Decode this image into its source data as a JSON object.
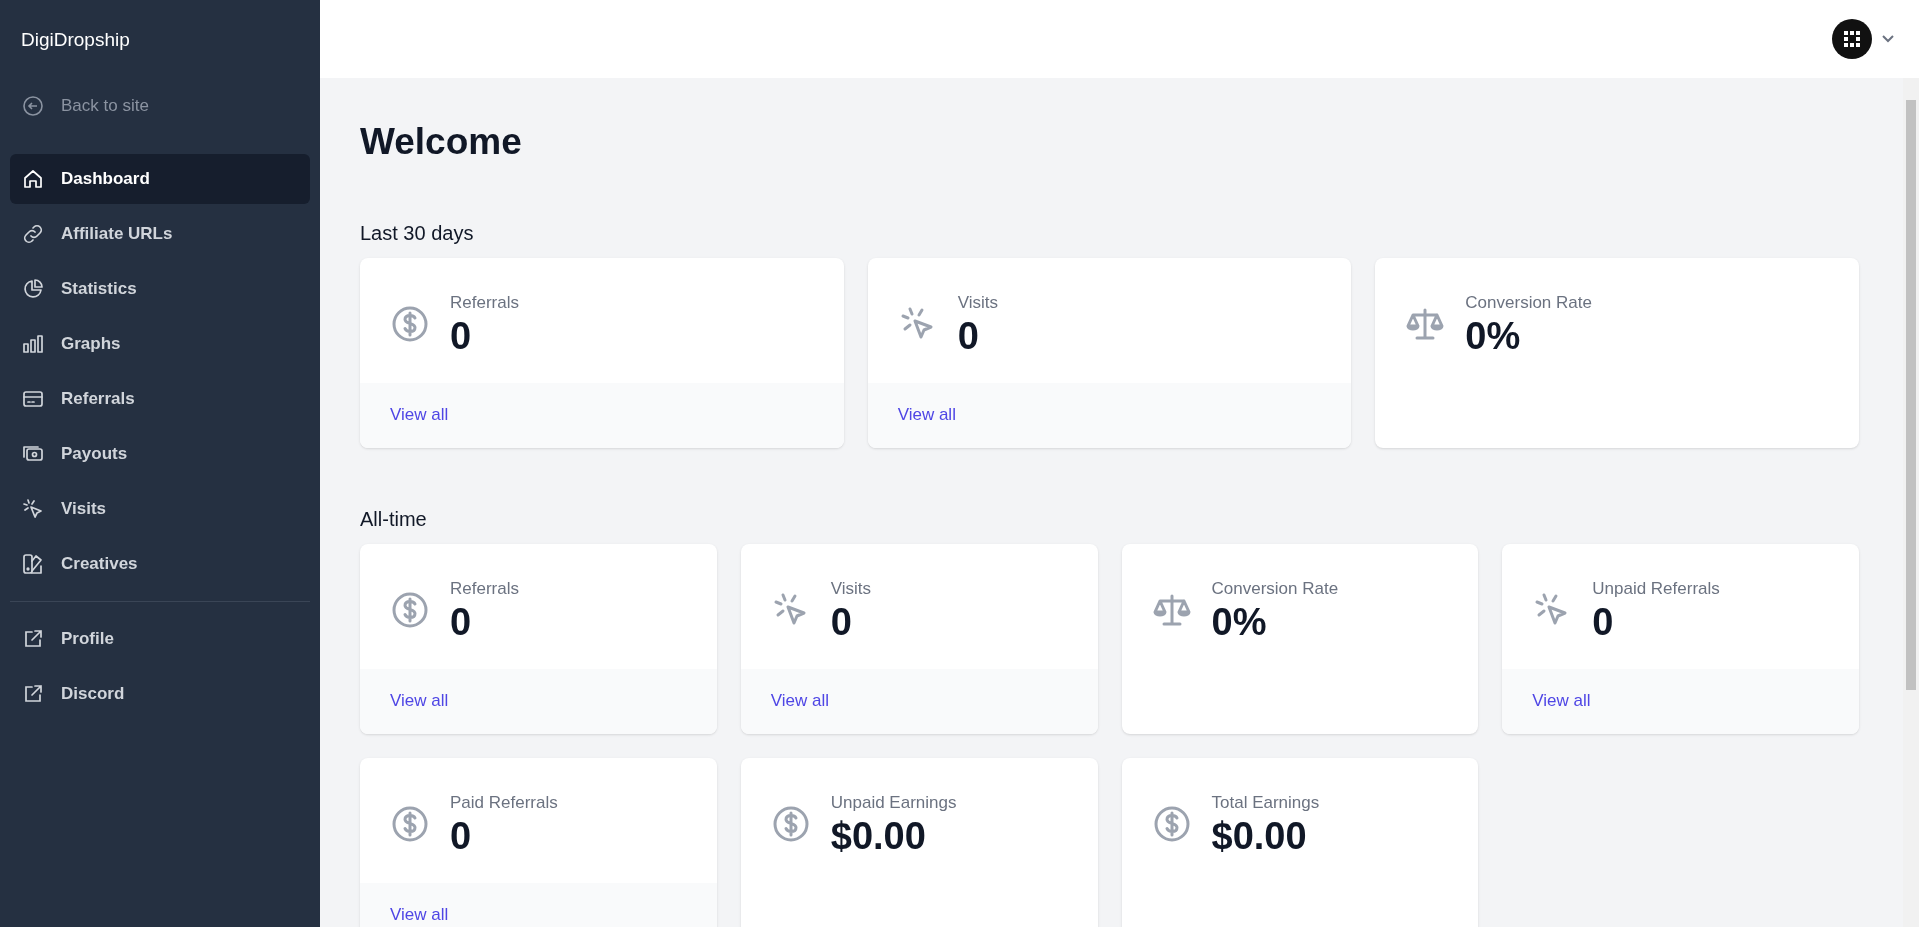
{
  "sidebar": {
    "brand": "DigiDropship",
    "back_link": "Back to site",
    "items": [
      {
        "label": "Dashboard",
        "selected": true
      },
      {
        "label": "Affiliate URLs",
        "selected": false
      },
      {
        "label": "Statistics",
        "selected": false
      },
      {
        "label": "Graphs",
        "selected": false
      },
      {
        "label": "Referrals",
        "selected": false
      },
      {
        "label": "Payouts",
        "selected": false
      },
      {
        "label": "Visits",
        "selected": false
      },
      {
        "label": "Creatives",
        "selected": false
      }
    ],
    "external_links": [
      "Profile",
      "Discord"
    ]
  },
  "page": {
    "title": "Welcome",
    "sections": [
      {
        "heading": "Last 30 days",
        "cards": [
          {
            "kind": "money",
            "label": "Referrals",
            "value": "0",
            "link": "View all"
          },
          {
            "kind": "click",
            "label": "Visits",
            "value": "0",
            "link": "View all"
          },
          {
            "kind": "ratio",
            "label": "Conversion Rate",
            "value": "0%"
          }
        ]
      },
      {
        "heading": "All-time",
        "cards": [
          {
            "kind": "money",
            "label": "Referrals",
            "value": "0",
            "link": "View all"
          },
          {
            "kind": "click",
            "label": "Visits",
            "value": "0",
            "link": "View all"
          },
          {
            "kind": "ratio",
            "label": "Conversion Rate",
            "value": "0%"
          },
          {
            "kind": "click",
            "label": "Unpaid Referrals",
            "value": "0",
            "link": "View all"
          },
          {
            "kind": "money",
            "label": "Paid Referrals",
            "value": "0",
            "link": "View all"
          },
          {
            "kind": "money",
            "label": "Unpaid Earnings",
            "value": "$0.00"
          },
          {
            "kind": "money",
            "label": "Total Earnings",
            "value": "$0.00"
          }
        ]
      }
    ]
  }
}
